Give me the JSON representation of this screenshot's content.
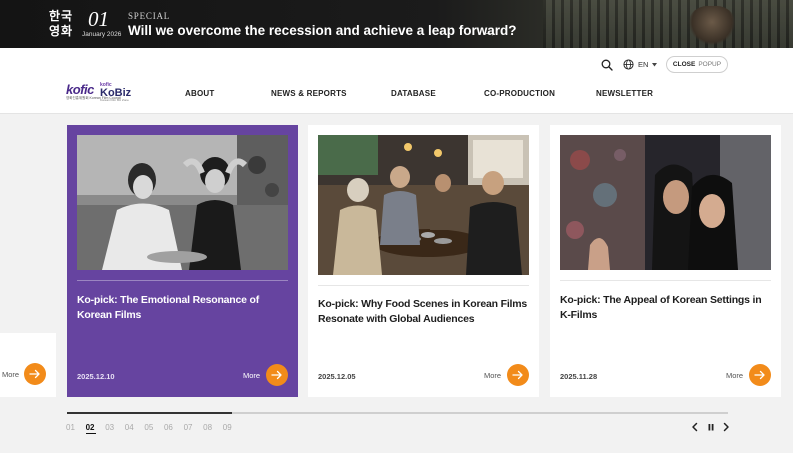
{
  "banner": {
    "korean": "한국영화",
    "issue_number": "01",
    "issue_date": "January 2026",
    "label": "SPECIAL",
    "headline": "Will we overcome the recession and achieve a leap forward?",
    "arrow": "→"
  },
  "header": {
    "language": "EN",
    "close_popup": {
      "strong": "CLOSE",
      "light": "POPUP"
    },
    "logo": {
      "kofic": "kofic",
      "kofic_sub": "영화진흥위원회 Korean Film Council",
      "kobiz_top": "kofic",
      "kobiz": "KoBiz",
      "kobiz_sub": "Korean Film Biz Zone"
    },
    "nav": [
      "ABOUT",
      "NEWS & REPORTS",
      "DATABASE",
      "CO-PRODUCTION",
      "NEWSLETTER"
    ]
  },
  "cards": [
    {
      "title": "Ko-pick: The Emotional Resonance of Korean Films",
      "date": "2025.12.10",
      "more": "More",
      "active": true
    },
    {
      "title": "Ko-pick: Why Food Scenes in Korean Films Resonate with Global Audiences",
      "date": "2025.12.05",
      "more": "More",
      "active": false
    },
    {
      "title": "Ko-pick: The Appeal of Korean Settings in K-Films",
      "date": "2025.11.28",
      "more": "More",
      "active": false
    }
  ],
  "partial_card": {
    "more": "More"
  },
  "pager": {
    "pages": [
      "01",
      "02",
      "03",
      "04",
      "05",
      "06",
      "07",
      "08",
      "09"
    ],
    "current": "02",
    "progress": 0.25
  },
  "colors": {
    "accent_purple": "#6644a0",
    "accent_orange": "#f28b1a"
  },
  "icons": [
    "search-icon",
    "globe-icon",
    "caret-down-icon",
    "arrow-right-icon",
    "chevron-left-icon",
    "pause-icon",
    "chevron-right-icon"
  ]
}
